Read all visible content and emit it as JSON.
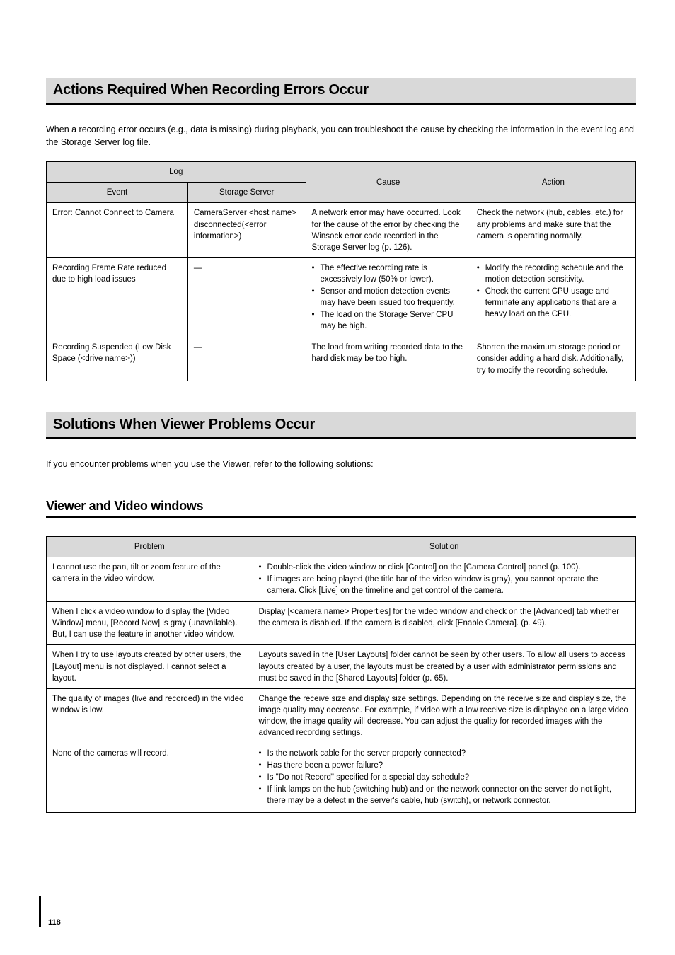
{
  "sections": {
    "recordingErrors": {
      "title": "Actions Required When Recording Errors Occur",
      "intro": "When a recording error occurs (e.g., data is missing) during playback, you can troubleshoot the cause by checking the information in the event log and the Storage Server log file.",
      "headers": {
        "log": "Log",
        "event": "Event",
        "storage": "Storage Server",
        "cause": "Cause",
        "action": "Action"
      },
      "rows": [
        {
          "event": "Error: Cannot Connect to Camera",
          "storage": "CameraServer <host name> disconnected(<error information>)",
          "cause": "A network error may have occurred. Look for the cause of the error by checking the Winsock error code recorded in the Storage Server log (p. 126).",
          "action": "Check the network (hub, cables, etc.) for any problems and make sure that the camera is operating normally."
        },
        {
          "event": "Recording Frame Rate reduced due to high load issues",
          "storage": "—",
          "cause_bullets": [
            "The effective recording rate is excessively low (50% or lower).",
            "Sensor and motion detection events may have been issued too frequently.",
            "The load on the Storage Server CPU may be high."
          ],
          "action_bullets": [
            "Modify the recording schedule and the motion detection sensitivity.",
            "Check the current CPU usage and terminate any applications that are a heavy load on the CPU."
          ]
        },
        {
          "event": "Recording Suspended (Low Disk Space (<drive name>))",
          "storage": "—",
          "cause": "The load from writing recorded data to the hard disk may be too high.",
          "action": "Shorten the maximum storage period or consider adding a hard disk. Additionally, try to modify the recording schedule."
        }
      ]
    },
    "viewerProblems": {
      "title": "Solutions When Viewer Problems Occur",
      "intro": "If you encounter problems when you use the Viewer, refer to the following solutions:",
      "subHeading": "Viewer and Video windows",
      "headers": {
        "problem": "Problem",
        "solution": "Solution"
      },
      "rows": [
        {
          "problem": "I cannot use the pan, tilt or zoom feature of the camera in the video window.",
          "solution_bullets": [
            "Double-click the video window or click [Control] on the [Camera Control] panel (p. 100).",
            "If images are being played (the title bar of the video window is gray), you cannot operate the camera. Click [Live] on the timeline and get control of the camera."
          ]
        },
        {
          "problem": "When I click a video window to display the [Video Window] menu, [Record Now] is gray (unavailable). But, I can use the feature in another video window.",
          "solution": "Display [<camera name> Properties] for the video window and check on the [Advanced] tab whether the camera is disabled. If the camera is disabled, click [Enable Camera]. (p. 49)."
        },
        {
          "problem": "When I try to use layouts created by other users, the [Layout] menu is not displayed. I cannot select a layout.",
          "solution": "Layouts saved in the [User Layouts] folder cannot be seen by other users. To allow all users to access layouts created by a user, the layouts must be created by a user with administrator permissions and must be saved in the [Shared Layouts] folder (p. 65)."
        },
        {
          "problem": "The quality of images (live and recorded) in the video window is low.",
          "solution": "Change the receive size and display size settings. Depending on the receive size and display size, the image quality may decrease. For example, if video with a low receive size is displayed on a large video window, the image quality will decrease. You can adjust the quality for recorded images with the advanced recording settings."
        },
        {
          "problem": "None of the cameras will record.",
          "solution_bullets": [
            "Is the network cable for the server properly connected?",
            "Has there been a power failure?",
            "Is \"Do not Record\" specified for a special day schedule?",
            "If link lamps on the hub (switching hub) and on the network connector on the server do not light, there may be a defect in the server's cable, hub (switch), or network connector."
          ]
        }
      ]
    }
  },
  "pageNumber": "118"
}
